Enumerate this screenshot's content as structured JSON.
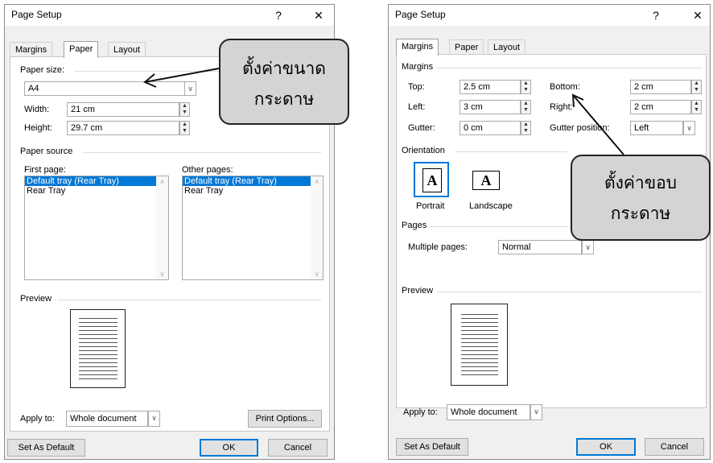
{
  "left": {
    "title": "Page Setup",
    "help": "?",
    "close": "✕",
    "tabs": [
      "Margins",
      "Paper",
      "Layout"
    ],
    "paper_size_label": "Paper size:",
    "paper_size_value": "A4",
    "width_label": "Width:",
    "width_value": "21 cm",
    "height_label": "Height:",
    "height_value": "29.7 cm",
    "paper_source_label": "Paper source",
    "first_page_label": "First page:",
    "other_pages_label": "Other pages:",
    "first_items": [
      "Default tray (Rear Tray)",
      "Rear Tray"
    ],
    "other_items": [
      "Default tray (Rear Tray)",
      "Rear Tray"
    ],
    "preview_label": "Preview",
    "apply_label": "Apply to:",
    "apply_value": "Whole document",
    "print_options": "Print Options...",
    "set_default": "Set As Default",
    "ok": "OK",
    "cancel": "Cancel"
  },
  "right": {
    "title": "Page Setup",
    "help": "?",
    "close": "✕",
    "tabs": [
      "Margins",
      "Paper",
      "Layout"
    ],
    "margins_label": "Margins",
    "top_label": "Top:",
    "top_value": "2.5 cm",
    "bottom_label": "Bottom:",
    "bottom_value": "2 cm",
    "left_label": "Left:",
    "left_value": "3 cm",
    "right_label": "Right:",
    "right_value": "2 cm",
    "gutter_label": "Gutter:",
    "gutter_value": "0 cm",
    "gutter_pos_label": "Gutter position:",
    "gutter_pos_value": "Left",
    "orientation_label": "Orientation",
    "portrait": "Portrait",
    "landscape": "Landscape",
    "orient_glyph": "A",
    "pages_label": "Pages",
    "multiple_pages_label": "Multiple pages:",
    "multiple_pages_value": "Normal",
    "preview_label": "Preview",
    "apply_label": "Apply to:",
    "apply_value": "Whole document",
    "set_default": "Set As Default",
    "ok": "OK",
    "cancel": "Cancel"
  },
  "callouts": {
    "paper": [
      "ตั้งค่าขนาด",
      "กระดาษ"
    ],
    "margins": [
      "ตั้งค่าขอบ",
      "กระดาษ"
    ]
  }
}
